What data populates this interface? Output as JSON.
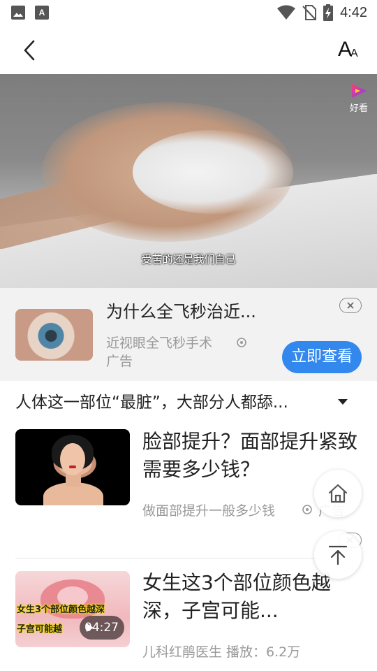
{
  "status_bar": {
    "time": "4:42",
    "left_icons": [
      "image-icon",
      "font-download-icon"
    ],
    "right_icons": [
      "wifi-icon",
      "no-sim-icon",
      "battery-charging-icon"
    ]
  },
  "header": {
    "back_icon": "chevron-left-icon",
    "font_size_icon": "font-size-icon",
    "font_size_big": "A",
    "font_size_small": "A"
  },
  "video": {
    "subtitle": "受苦的还是我们自己",
    "brand_label": "好看"
  },
  "ad_banner": {
    "title": "为什么全飞秒治近...",
    "subtitle": "近视眼全飞秒手术",
    "ad_label": "广告",
    "cta_label": "立即查看",
    "cta_color": "#3388ee"
  },
  "related": {
    "title": "人体这一部位“最脏”，大部分人都舔..."
  },
  "feed": [
    {
      "title": "脸部提升？面部提升紧致需要多少钱？",
      "meta": "做面部提升一般多少钱",
      "ad_label": "广告"
    },
    {
      "title": "女生这3个部位颜色越深，子宫可能...",
      "thumb_text_1": "女生3个部位颜色越深",
      "thumb_text_2": "子宫可能越",
      "duration": "04:27",
      "meta": "儿科红鹃医生  播放：6.2万"
    }
  ],
  "floating": {
    "home_icon": "home-icon",
    "top_icon": "back-to-top-icon"
  }
}
